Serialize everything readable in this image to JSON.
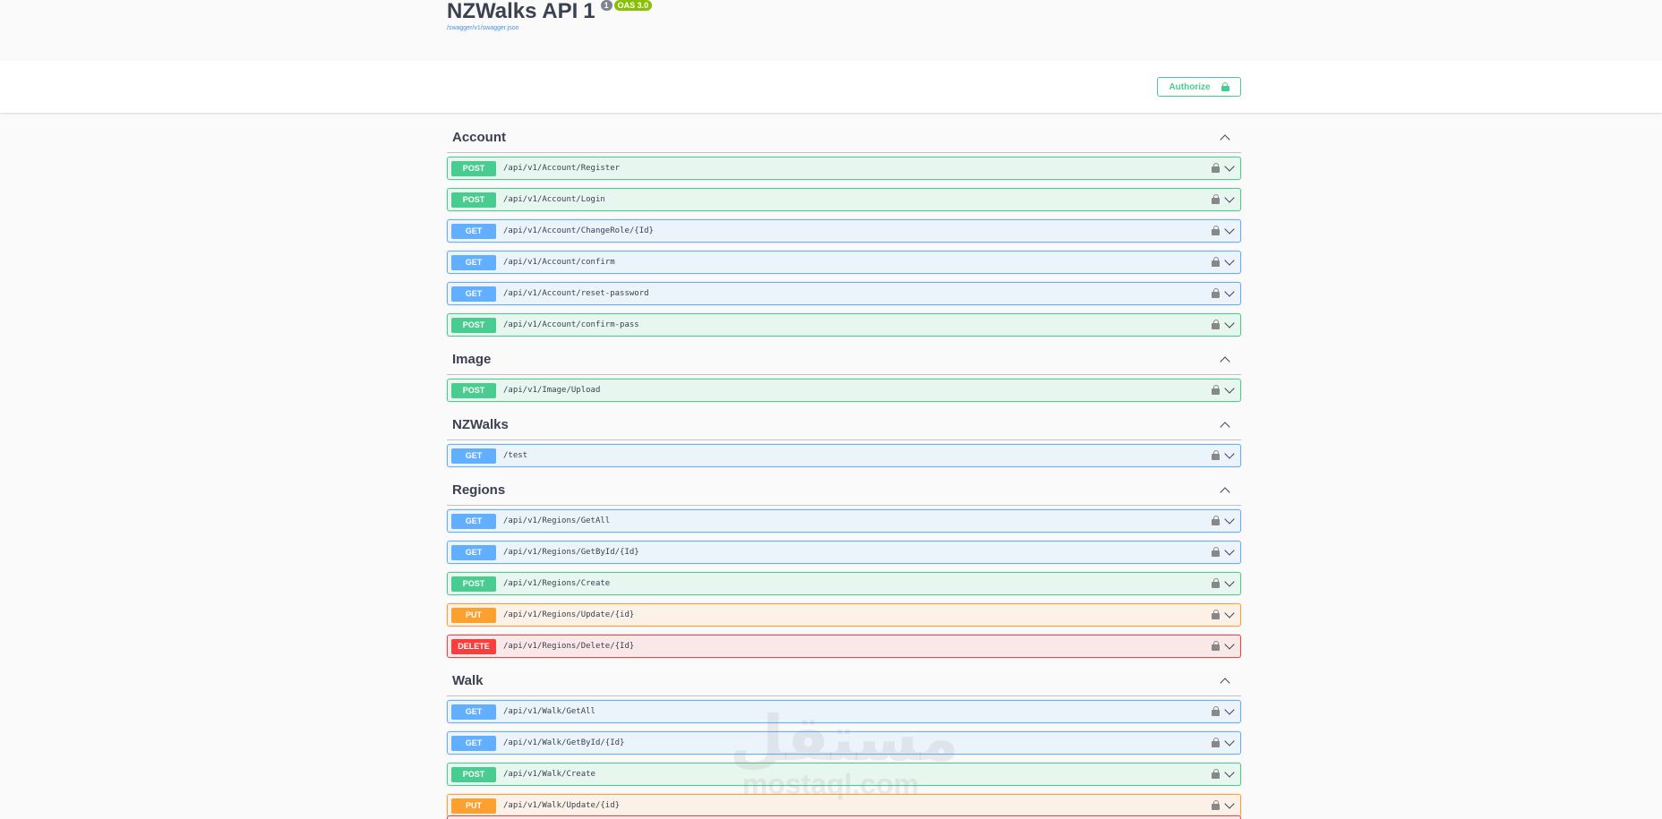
{
  "info": {
    "title": "NZWalks API",
    "version": "1",
    "oas": "OAS 3.0",
    "spec_link": "/swagger/v1/swagger.json"
  },
  "toolbar": {
    "authorize_label": "Authorize"
  },
  "tags": [
    {
      "name": "Account",
      "operations": [
        {
          "method": "POST",
          "path": "/api/v1/Account/Register"
        },
        {
          "method": "POST",
          "path": "/api/v1/Account/Login"
        },
        {
          "method": "GET",
          "path": "/api/v1/Account/ChangeRole/{Id}"
        },
        {
          "method": "GET",
          "path": "/api/v1/Account/confirm"
        },
        {
          "method": "GET",
          "path": "/api/v1/Account/reset-password"
        },
        {
          "method": "POST",
          "path": "/api/v1/Account/confirm-pass"
        }
      ]
    },
    {
      "name": "Image",
      "operations": [
        {
          "method": "POST",
          "path": "/api/v1/Image/Upload"
        }
      ]
    },
    {
      "name": "NZWalks",
      "operations": [
        {
          "method": "GET",
          "path": "/test"
        }
      ]
    },
    {
      "name": "Regions",
      "operations": [
        {
          "method": "GET",
          "path": "/api/v1/Regions/GetAll"
        },
        {
          "method": "GET",
          "path": "/api/v1/Regions/GetById/{Id}"
        },
        {
          "method": "POST",
          "path": "/api/v1/Regions/Create"
        },
        {
          "method": "PUT",
          "path": "/api/v1/Regions/Update/{id}"
        },
        {
          "method": "DELETE",
          "path": "/api/v1/Regions/Delete/{Id}"
        }
      ]
    },
    {
      "name": "Walk",
      "operations": [
        {
          "method": "GET",
          "path": "/api/v1/Walk/GetAll"
        },
        {
          "method": "GET",
          "path": "/api/v1/Walk/GetById/{Id}"
        },
        {
          "method": "POST",
          "path": "/api/v1/Walk/Create"
        },
        {
          "method": "PUT",
          "path": "/api/v1/Walk/Update/{id}"
        }
      ]
    }
  ],
  "watermark": {
    "arabic": "مستقل",
    "latin": "mostaql.com"
  }
}
